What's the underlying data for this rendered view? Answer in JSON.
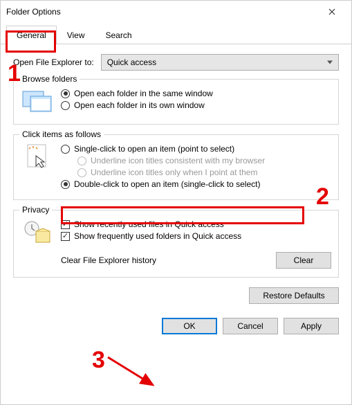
{
  "window": {
    "title": "Folder Options"
  },
  "tabs": {
    "general": "General",
    "view": "View",
    "search": "Search"
  },
  "open_explorer": {
    "label": "Open File Explorer to:",
    "selected": "Quick access"
  },
  "browse_folders": {
    "title": "Browse folders",
    "opt_same": "Open each folder in the same window",
    "opt_own": "Open each folder in its own window"
  },
  "click_items": {
    "title": "Click items as follows",
    "opt_single": "Single-click to open an item (point to select)",
    "opt_underline_browser": "Underline icon titles consistent with my browser",
    "opt_underline_point": "Underline icon titles only when I point at them",
    "opt_double": "Double-click to open an item (single-click to select)"
  },
  "privacy": {
    "title": "Privacy",
    "chk_recent": "Show recently used files in Quick access",
    "chk_frequent": "Show frequently used folders in Quick access",
    "clear_label": "Clear File Explorer history",
    "clear_btn": "Clear"
  },
  "buttons": {
    "restore": "Restore Defaults",
    "ok": "OK",
    "cancel": "Cancel",
    "apply": "Apply"
  },
  "annotations": {
    "n1": "1",
    "n2": "2",
    "n3": "3"
  }
}
